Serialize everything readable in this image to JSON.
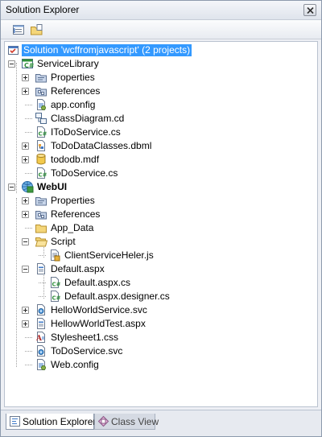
{
  "window": {
    "title": "Solution Explorer"
  },
  "toolbar": {
    "buttons": [
      "properties-icon",
      "show-all-files-icon"
    ]
  },
  "tree": {
    "solution": "Solution 'wcffromjavascript' (2 projects)",
    "items": [
      {
        "label": "ServiceLibrary",
        "icon": "csharp-project-icon"
      },
      {
        "label": "Properties",
        "icon": "properties-folder-icon"
      },
      {
        "label": "References",
        "icon": "references-folder-icon"
      },
      {
        "label": "app.config",
        "icon": "config-file-icon"
      },
      {
        "label": "ClassDiagram.cd",
        "icon": "class-diagram-icon"
      },
      {
        "label": "IToDoService.cs",
        "icon": "cs-file-icon"
      },
      {
        "label": "ToDoDataClasses.dbml",
        "icon": "dbml-file-icon"
      },
      {
        "label": "tododb.mdf",
        "icon": "database-icon"
      },
      {
        "label": "ToDoService.cs",
        "icon": "cs-file-icon"
      },
      {
        "label": "WebUI",
        "icon": "web-project-icon"
      },
      {
        "label": "Properties",
        "icon": "properties-folder-icon"
      },
      {
        "label": "References",
        "icon": "references-folder-icon"
      },
      {
        "label": "App_Data",
        "icon": "folder-icon"
      },
      {
        "label": "Script",
        "icon": "folder-open-icon"
      },
      {
        "label": "ClientServiceHeler.js",
        "icon": "js-file-icon"
      },
      {
        "label": "Default.aspx",
        "icon": "aspx-file-icon"
      },
      {
        "label": "Default.aspx.cs",
        "icon": "cs-file-icon"
      },
      {
        "label": "Default.aspx.designer.cs",
        "icon": "cs-file-icon"
      },
      {
        "label": "HelloWorldService.svc",
        "icon": "svc-file-icon"
      },
      {
        "label": "HellowWorldTest.aspx",
        "icon": "aspx-file-icon"
      },
      {
        "label": "Stylesheet1.css",
        "icon": "css-file-icon"
      },
      {
        "label": "ToDoService.svc",
        "icon": "svc-file-icon"
      },
      {
        "label": "Web.config",
        "icon": "config-file-icon"
      }
    ]
  },
  "tabs": [
    {
      "label": "Solution Explorer",
      "icon": "solution-explorer-icon",
      "active": true
    },
    {
      "label": "Class View",
      "icon": "class-view-icon",
      "active": false
    }
  ],
  "colors": {
    "selection": "#3399ff",
    "accent": "#2b5797"
  }
}
